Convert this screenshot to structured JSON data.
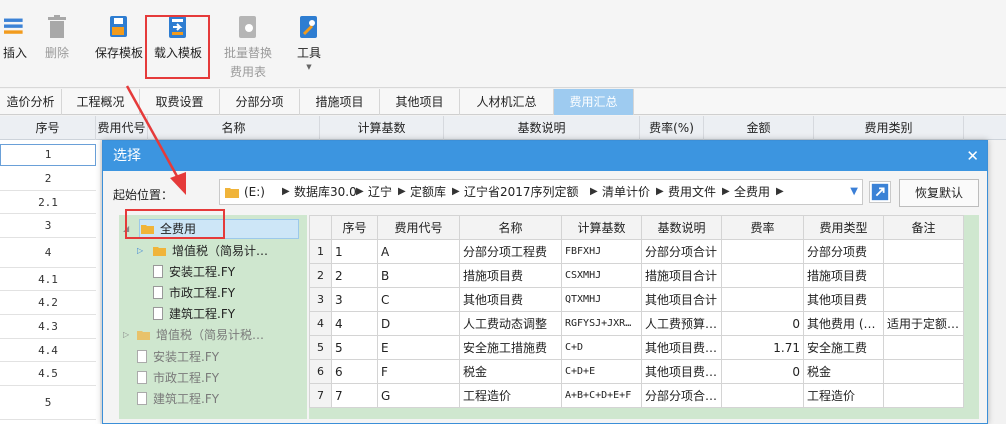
{
  "toolbar": {
    "insert": "插入",
    "delete": "删除",
    "save_template": "保存模板",
    "load_template": "载入模板",
    "batch_replace_1": "批量替换",
    "batch_replace_2": "费用表",
    "tools": "工具"
  },
  "tabs": [
    "造价分析",
    "工程概况",
    "取费设置",
    "分部分项",
    "措施项目",
    "其他项目",
    "人材机汇总",
    "费用汇总"
  ],
  "grid": {
    "headers": [
      "序号",
      "费用代号",
      "名称",
      "计算基数",
      "基数说明",
      "费率(%)",
      "金额",
      "费用类别"
    ],
    "rows": [
      "1",
      "2",
      "2.1",
      "3",
      "4",
      "4.1",
      "4.2",
      "4.3",
      "4.4",
      "4.5",
      "5"
    ]
  },
  "dialog": {
    "title": "选择",
    "close": "✕",
    "start_label": "起始位置：",
    "path": [
      "(E:)",
      "数据库30.0",
      "辽宁",
      "定额库",
      "辽宁省2017序列定额",
      "清单计价",
      "费用文件",
      "全费用"
    ],
    "restore": "恢复默认",
    "tree": [
      {
        "label": "全费用",
        "type": "folder",
        "dim": false
      },
      {
        "label": "增值税（简易计…",
        "type": "folder",
        "dim": false
      },
      {
        "label": "安装工程.FY",
        "type": "file",
        "dim": false
      },
      {
        "label": "市政工程.FY",
        "type": "file",
        "dim": false
      },
      {
        "label": "建筑工程.FY",
        "type": "file",
        "dim": false
      },
      {
        "label": "增值税（简易计税…",
        "type": "folder",
        "dim": true
      },
      {
        "label": "安装工程.FY",
        "type": "file",
        "dim": true
      },
      {
        "label": "市政工程.FY",
        "type": "file",
        "dim": true
      },
      {
        "label": "建筑工程.FY",
        "type": "file",
        "dim": true
      }
    ],
    "table": {
      "headers": [
        "序号",
        "费用代号",
        "名称",
        "计算基数",
        "基数说明",
        "费率",
        "费用类型",
        "备注"
      ],
      "rows": [
        [
          "1",
          "1",
          "A",
          "分部分项工程费",
          "FBFXHJ",
          "分部分项合计",
          "",
          "分部分项费",
          ""
        ],
        [
          "2",
          "2",
          "B",
          "措施项目费",
          "CSXMHJ",
          "措施项目合计",
          "",
          "措施项目费",
          ""
        ],
        [
          "3",
          "3",
          "C",
          "其他项目费",
          "QTXMHJ",
          "其他项目合计",
          "",
          "其他项目费",
          ""
        ],
        [
          "4",
          "4",
          "D",
          "人工费动态调整",
          "RGFYSJ+JXR…",
          "人工费预算…",
          "0",
          "其他费用 (…",
          "适用于定额…"
        ],
        [
          "5",
          "5",
          "E",
          "安全施工措施费",
          "C+D",
          "其他项目费…",
          "1.71",
          "安全施工费",
          ""
        ],
        [
          "6",
          "6",
          "F",
          "税金",
          "C+D+E",
          "其他项目费…",
          "0",
          "税金",
          ""
        ],
        [
          "7",
          "7",
          "G",
          "工程造价",
          "A+B+C+D+E+F",
          "分部分项合…",
          "",
          "工程造价",
          ""
        ]
      ]
    }
  },
  "colors": {
    "accent": "#3c95e0",
    "highlight": "#e53a3a",
    "tree_bg": "#cfe7cf"
  }
}
